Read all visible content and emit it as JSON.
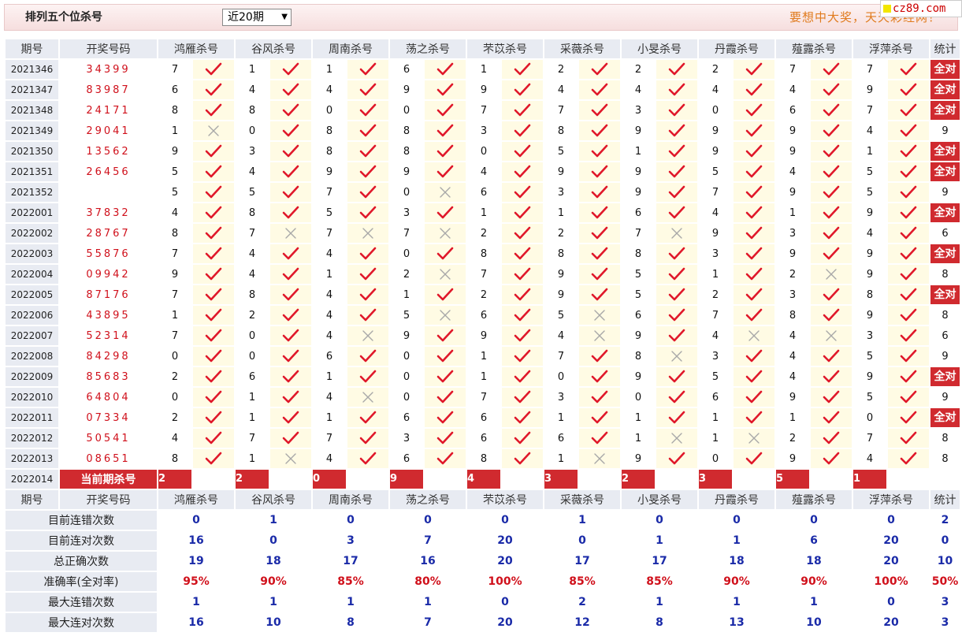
{
  "header": {
    "title": "排列五个位杀号",
    "period_select": "近20期",
    "slogan": "要想中大奖，天天彩经网！",
    "logo": "cz89.com"
  },
  "columns": {
    "issue": "期号",
    "draw": "开奖号码",
    "experts": [
      "鸿雁杀号",
      "谷风杀号",
      "周南杀号",
      "荡之杀号",
      "芣苡杀号",
      "采薇杀号",
      "小旻杀号",
      "丹霞杀号",
      "薤露杀号",
      "浮萍杀号"
    ],
    "stat": "统计"
  },
  "all_correct_label": "全对",
  "rows": [
    {
      "issue": "2021346",
      "draw": "34399",
      "k": [
        7,
        1,
        1,
        6,
        1,
        2,
        2,
        2,
        7,
        7
      ],
      "r": [
        1,
        1,
        1,
        1,
        1,
        1,
        1,
        1,
        1,
        1
      ],
      "stat": "全对"
    },
    {
      "issue": "2021347",
      "draw": "83987",
      "k": [
        6,
        4,
        4,
        9,
        9,
        4,
        4,
        4,
        4,
        9
      ],
      "r": [
        1,
        1,
        1,
        1,
        1,
        1,
        1,
        1,
        1,
        1
      ],
      "stat": "全对"
    },
    {
      "issue": "2021348",
      "draw": "24171",
      "k": [
        8,
        8,
        0,
        0,
        7,
        7,
        3,
        0,
        6,
        7
      ],
      "r": [
        1,
        1,
        1,
        1,
        1,
        1,
        1,
        1,
        1,
        1
      ],
      "stat": "全对"
    },
    {
      "issue": "2021349",
      "draw": "29041",
      "k": [
        1,
        0,
        8,
        8,
        3,
        8,
        9,
        9,
        9,
        4
      ],
      "r": [
        0,
        1,
        1,
        1,
        1,
        1,
        1,
        1,
        1,
        1
      ],
      "stat": "9"
    },
    {
      "issue": "2021350",
      "draw": "13562",
      "k": [
        9,
        3,
        8,
        8,
        0,
        5,
        1,
        9,
        9,
        1
      ],
      "r": [
        1,
        1,
        1,
        1,
        1,
        1,
        1,
        1,
        1,
        1
      ],
      "stat": "全对"
    },
    {
      "issue": "2021351",
      "draw": "26456",
      "k": [
        5,
        4,
        9,
        9,
        4,
        9,
        9,
        5,
        4,
        5
      ],
      "r": [
        1,
        1,
        1,
        1,
        1,
        1,
        1,
        1,
        1,
        1
      ],
      "stat": "全对"
    },
    {
      "issue": "2021352",
      "draw": "",
      "k": [
        5,
        5,
        7,
        0,
        6,
        3,
        9,
        7,
        9,
        5
      ],
      "r": [
        1,
        1,
        1,
        0,
        1,
        1,
        1,
        1,
        1,
        1
      ],
      "stat": "9"
    },
    {
      "issue": "2022001",
      "draw": "37832",
      "k": [
        4,
        8,
        5,
        3,
        1,
        1,
        6,
        4,
        1,
        9
      ],
      "r": [
        1,
        1,
        1,
        1,
        1,
        1,
        1,
        1,
        1,
        1
      ],
      "stat": "全对"
    },
    {
      "issue": "2022002",
      "draw": "28767",
      "k": [
        8,
        7,
        7,
        7,
        2,
        2,
        7,
        9,
        3,
        4
      ],
      "r": [
        1,
        0,
        0,
        0,
        1,
        1,
        0,
        1,
        1,
        1
      ],
      "stat": "6"
    },
    {
      "issue": "2022003",
      "draw": "55876",
      "k": [
        7,
        4,
        4,
        0,
        8,
        8,
        8,
        3,
        9,
        9
      ],
      "r": [
        1,
        1,
        1,
        1,
        1,
        1,
        1,
        1,
        1,
        1
      ],
      "stat": "全对"
    },
    {
      "issue": "2022004",
      "draw": "09942",
      "k": [
        9,
        4,
        1,
        2,
        7,
        9,
        5,
        1,
        2,
        9
      ],
      "r": [
        1,
        1,
        1,
        0,
        1,
        1,
        1,
        1,
        0,
        1
      ],
      "stat": "8"
    },
    {
      "issue": "2022005",
      "draw": "87176",
      "k": [
        7,
        8,
        4,
        1,
        2,
        9,
        5,
        2,
        3,
        8
      ],
      "r": [
        1,
        1,
        1,
        1,
        1,
        1,
        1,
        1,
        1,
        1
      ],
      "stat": "全对"
    },
    {
      "issue": "2022006",
      "draw": "43895",
      "k": [
        1,
        2,
        4,
        5,
        6,
        5,
        6,
        7,
        8,
        9
      ],
      "r": [
        1,
        1,
        1,
        0,
        1,
        0,
        1,
        1,
        1,
        1
      ],
      "stat": "8"
    },
    {
      "issue": "2022007",
      "draw": "52314",
      "k": [
        7,
        0,
        4,
        9,
        9,
        4,
        9,
        4,
        4,
        3
      ],
      "r": [
        1,
        1,
        0,
        1,
        1,
        0,
        1,
        0,
        0,
        1
      ],
      "stat": "6"
    },
    {
      "issue": "2022008",
      "draw": "84298",
      "k": [
        0,
        0,
        6,
        0,
        1,
        7,
        8,
        3,
        4,
        5
      ],
      "r": [
        1,
        1,
        1,
        1,
        1,
        1,
        0,
        1,
        1,
        1
      ],
      "stat": "9"
    },
    {
      "issue": "2022009",
      "draw": "85683",
      "k": [
        2,
        6,
        1,
        0,
        1,
        0,
        9,
        5,
        4,
        9
      ],
      "r": [
        1,
        1,
        1,
        1,
        1,
        1,
        1,
        1,
        1,
        1
      ],
      "stat": "全对"
    },
    {
      "issue": "2022010",
      "draw": "64804",
      "k": [
        0,
        1,
        4,
        0,
        7,
        3,
        0,
        6,
        9,
        5
      ],
      "r": [
        1,
        1,
        0,
        1,
        1,
        1,
        1,
        1,
        1,
        1
      ],
      "stat": "9"
    },
    {
      "issue": "2022011",
      "draw": "07334",
      "k": [
        2,
        1,
        1,
        6,
        6,
        1,
        1,
        1,
        1,
        0
      ],
      "r": [
        1,
        1,
        1,
        1,
        1,
        1,
        1,
        1,
        1,
        1
      ],
      "stat": "全对"
    },
    {
      "issue": "2022012",
      "draw": "50541",
      "k": [
        4,
        7,
        7,
        3,
        6,
        6,
        1,
        1,
        2,
        7
      ],
      "r": [
        1,
        1,
        1,
        1,
        1,
        1,
        0,
        0,
        1,
        1
      ],
      "stat": "8"
    },
    {
      "issue": "2022013",
      "draw": "08651",
      "k": [
        8,
        1,
        4,
        6,
        8,
        1,
        9,
        0,
        9,
        4
      ],
      "r": [
        1,
        0,
        1,
        1,
        1,
        0,
        1,
        1,
        1,
        1
      ],
      "stat": "8"
    }
  ],
  "current": {
    "issue": "2022014",
    "label": "当前期杀号",
    "k": [
      2,
      2,
      0,
      9,
      4,
      3,
      2,
      3,
      5,
      1
    ]
  },
  "stats_rows": [
    {
      "label": "目前连错次数",
      "vals": [
        "0",
        "1",
        "0",
        "0",
        "0",
        "1",
        "0",
        "0",
        "0",
        "0"
      ],
      "stat": "2",
      "red": false
    },
    {
      "label": "目前连对次数",
      "vals": [
        "16",
        "0",
        "3",
        "7",
        "20",
        "0",
        "1",
        "1",
        "6",
        "20"
      ],
      "stat": "0",
      "red": false
    },
    {
      "label": "总正确次数",
      "vals": [
        "19",
        "18",
        "17",
        "16",
        "20",
        "17",
        "17",
        "18",
        "18",
        "20"
      ],
      "stat": "10",
      "red": false
    },
    {
      "label": "准确率(全对率)",
      "vals": [
        "95%",
        "90%",
        "85%",
        "80%",
        "100%",
        "85%",
        "85%",
        "90%",
        "90%",
        "100%"
      ],
      "stat": "50%",
      "red": true
    },
    {
      "label": "最大连错次数",
      "vals": [
        "1",
        "1",
        "1",
        "1",
        "0",
        "2",
        "1",
        "1",
        "1",
        "0"
      ],
      "stat": "3",
      "red": false
    },
    {
      "label": "最大连对次数",
      "vals": [
        "16",
        "10",
        "8",
        "7",
        "20",
        "12",
        "8",
        "13",
        "10",
        "20"
      ],
      "stat": "3",
      "red": false
    }
  ],
  "colors": {
    "accent_red": "#d02a2f",
    "check_red": "#e0182a",
    "cross_gray": "#a8a8a8",
    "stat_blue": "#1a2aa8"
  }
}
